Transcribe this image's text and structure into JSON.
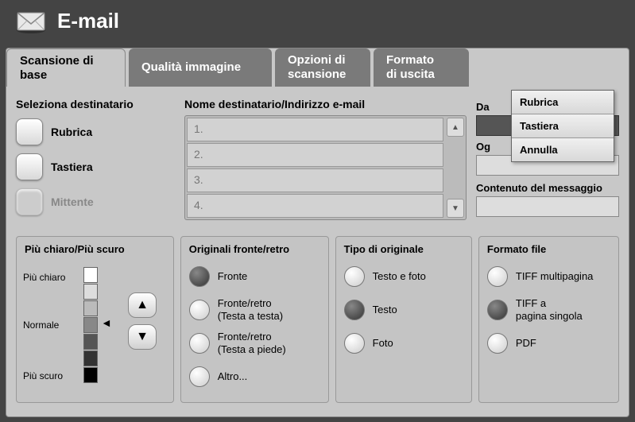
{
  "title": "E-mail",
  "tabs": [
    {
      "label": "Scansione di base"
    },
    {
      "label": "Qualità immagine"
    },
    {
      "label": "Opzioni di\nscansione"
    },
    {
      "label": "Formato\ndi uscita"
    }
  ],
  "select_recipient_label": "Seleziona destinatario",
  "dest_buttons": {
    "rubrica": "Rubrica",
    "tastiera": "Tastiera",
    "mittente": "Mittente"
  },
  "recipient_list_label": "Nome destinatario/Indirizzo e-mail",
  "list_rows": [
    "1.",
    "2.",
    "3.",
    "4."
  ],
  "right_fields": {
    "da": "Da",
    "oggetto": "Og",
    "contenuto": "Contenuto del messaggio"
  },
  "popup": {
    "rubrica": "Rubrica",
    "tastiera": "Tastiera",
    "annulla": "Annulla"
  },
  "darkness": {
    "title": "Più chiaro/Più scuro",
    "lighter": "Più chiaro",
    "normal": "Normale",
    "darker": "Più scuro"
  },
  "sides": {
    "title": "Originali fronte/retro",
    "opt1": "Fronte",
    "opt2": "Fronte/retro\n(Testa a testa)",
    "opt3": "Fronte/retro\n(Testa a piede)",
    "opt4": "Altro..."
  },
  "type": {
    "title": "Tipo di originale",
    "opt1": "Testo e foto",
    "opt2": "Testo",
    "opt3": "Foto"
  },
  "format": {
    "title": "Formato file",
    "opt1": "TIFF multipagina",
    "opt2": "TIFF a\npagina singola",
    "opt3": "PDF"
  }
}
